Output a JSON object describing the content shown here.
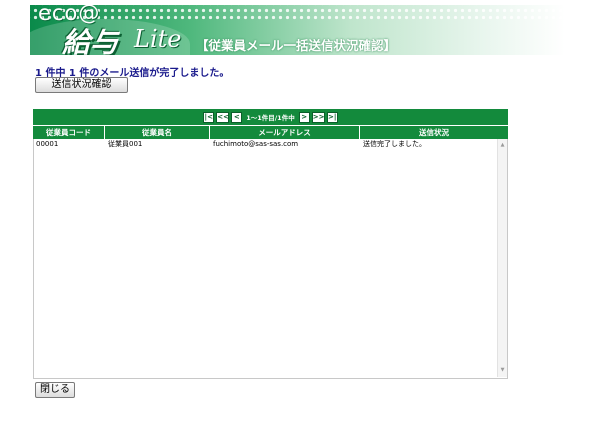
{
  "header": {
    "eco": "eco@",
    "logo_main": "給与",
    "logo_lite": "Lite",
    "page_title": "【従業員メール一括送信状況確認】"
  },
  "status_message": "1 件中 1 件のメール送信が完了しました。",
  "buttons": {
    "status_check": "送信状況確認",
    "close": "閉じる"
  },
  "pager": {
    "first": "|<",
    "prev_page": "<<",
    "prev": "<",
    "info": "1〜1件目/1件中",
    "next": ">",
    "next_page": ">>",
    "last": ">|"
  },
  "grid": {
    "columns": [
      "従業員コード",
      "従業員名",
      "メールアドレス",
      "送信状況"
    ],
    "rows": [
      {
        "code": "00001",
        "name": "従業員001",
        "email": "fuchimoto@sas-sas.com",
        "status": "送信完了しました。"
      }
    ]
  },
  "scrollbar": {
    "up": "▲",
    "down": "▼"
  }
}
